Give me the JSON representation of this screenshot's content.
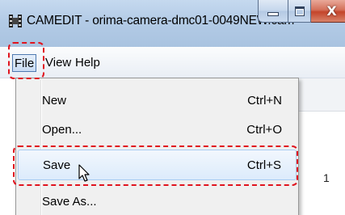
{
  "window": {
    "title": "CAMEDIT - orima-camera-dmc01-0049NEW.cam",
    "icon": "camera-app-icon",
    "caption_buttons": [
      "minimize-icon",
      "maximize-icon",
      "close-icon"
    ],
    "close_glyph": "X"
  },
  "menubar": {
    "items": [
      {
        "label": "File",
        "active": true
      },
      {
        "label": "View",
        "active": false
      },
      {
        "label": "Help",
        "active": false
      }
    ]
  },
  "file_menu": {
    "items": [
      {
        "label": "New",
        "shortcut": "Ctrl+N"
      },
      {
        "label": "Open...",
        "shortcut": "Ctrl+O"
      },
      {
        "label": "Save",
        "shortcut": "Ctrl+S",
        "hovered": true
      },
      {
        "label": "Save As...",
        "shortcut": ""
      }
    ]
  },
  "client": {
    "visible_value": "1"
  },
  "annotations": {
    "highlight_color": "#e0141e"
  }
}
